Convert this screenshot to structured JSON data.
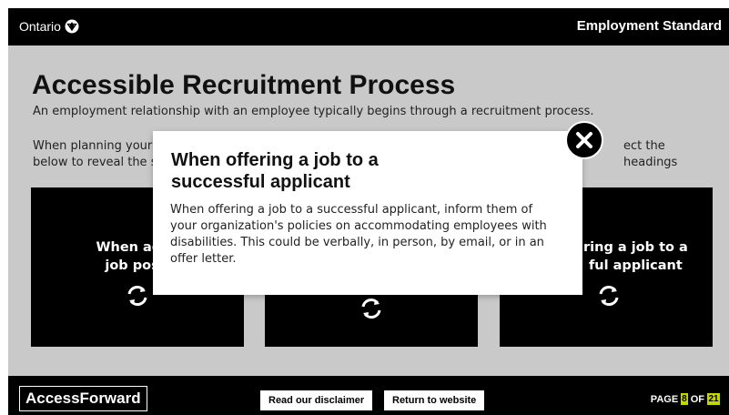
{
  "header": {
    "brand_label": "Ontario",
    "app_title": "Employment Standard"
  },
  "main": {
    "heading": "Accessible Recruitment Process",
    "intro": "An employment relationship with an employee typically begins through a recruitment process.",
    "instructions_visible": "When planning your",
    "instructions_end": "ect the headings",
    "instructions_line2": "below to reveal the s"
  },
  "cards": [
    {
      "label": "When adve… job posit…",
      "visible_line1": "When adve",
      "visible_line2": "job posit",
      "icon": "refresh-icon"
    },
    {
      "label": "",
      "icon": "refresh-icon"
    },
    {
      "label": "…ring a job to a …ful applicant",
      "visible_line1": "ring a job to a",
      "visible_line2": "ful applicant",
      "icon": "refresh-icon"
    }
  ],
  "modal": {
    "title": "When offering a job to a successful applicant",
    "body": "When offering a job to a successful applicant, inform them of your organization's policies on accommodating employees with disabilities. This could be verbally, in person, by email, or in an offer letter.",
    "close_icon": "close-icon"
  },
  "footer": {
    "logo": "AccessForward",
    "disclaimer_label": "Read our disclaimer",
    "return_label": "Return to website",
    "page_prefix": "PAGE",
    "page_current": "8",
    "page_of": "OF",
    "page_total": "21"
  },
  "colors": {
    "background": "#c9c9c9",
    "bars": "#000000",
    "page_badge": "#c3d600"
  }
}
